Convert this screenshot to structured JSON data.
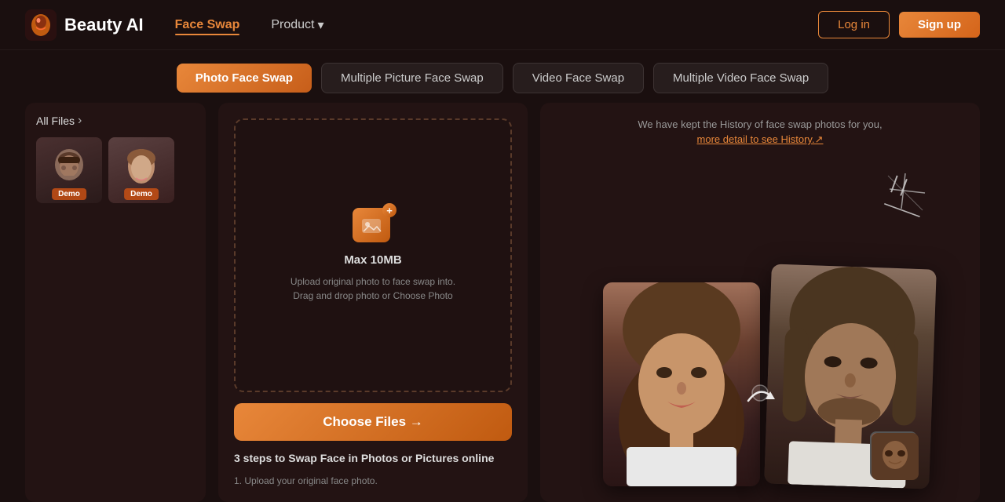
{
  "header": {
    "logo_text": "Beauty AI",
    "nav_face_swap": "Face Swap",
    "nav_product": "Product",
    "nav_product_arrow": "▾",
    "btn_login": "Log in",
    "btn_signup": "Sign up"
  },
  "tabs": [
    {
      "id": "photo",
      "label": "Photo Face Swap",
      "active": true
    },
    {
      "id": "multiple-photo",
      "label": "Multiple Picture Face Swap",
      "active": false
    },
    {
      "id": "video",
      "label": "Video Face Swap",
      "active": false
    },
    {
      "id": "multiple-video",
      "label": "Multiple Video Face Swap",
      "active": false
    }
  ],
  "left_panel": {
    "all_files": "All Files",
    "demos": [
      {
        "label": "Demo",
        "gender": "male"
      },
      {
        "label": "Demo",
        "gender": "female"
      }
    ]
  },
  "upload_zone": {
    "max_size": "Max 10MB",
    "description": "Upload original photo to face swap into. Drag and drop photo or Choose Photo",
    "plus_icon": "+"
  },
  "choose_files_btn": "Choose Files →",
  "steps": {
    "title": "3 steps to Swap Face in Photos or Pictures online",
    "step1": "1. Upload your original face photo."
  },
  "right_panel": {
    "history_text": "We have kept the History of face swap photos for you,",
    "history_link": "more detail to see History.↗"
  }
}
